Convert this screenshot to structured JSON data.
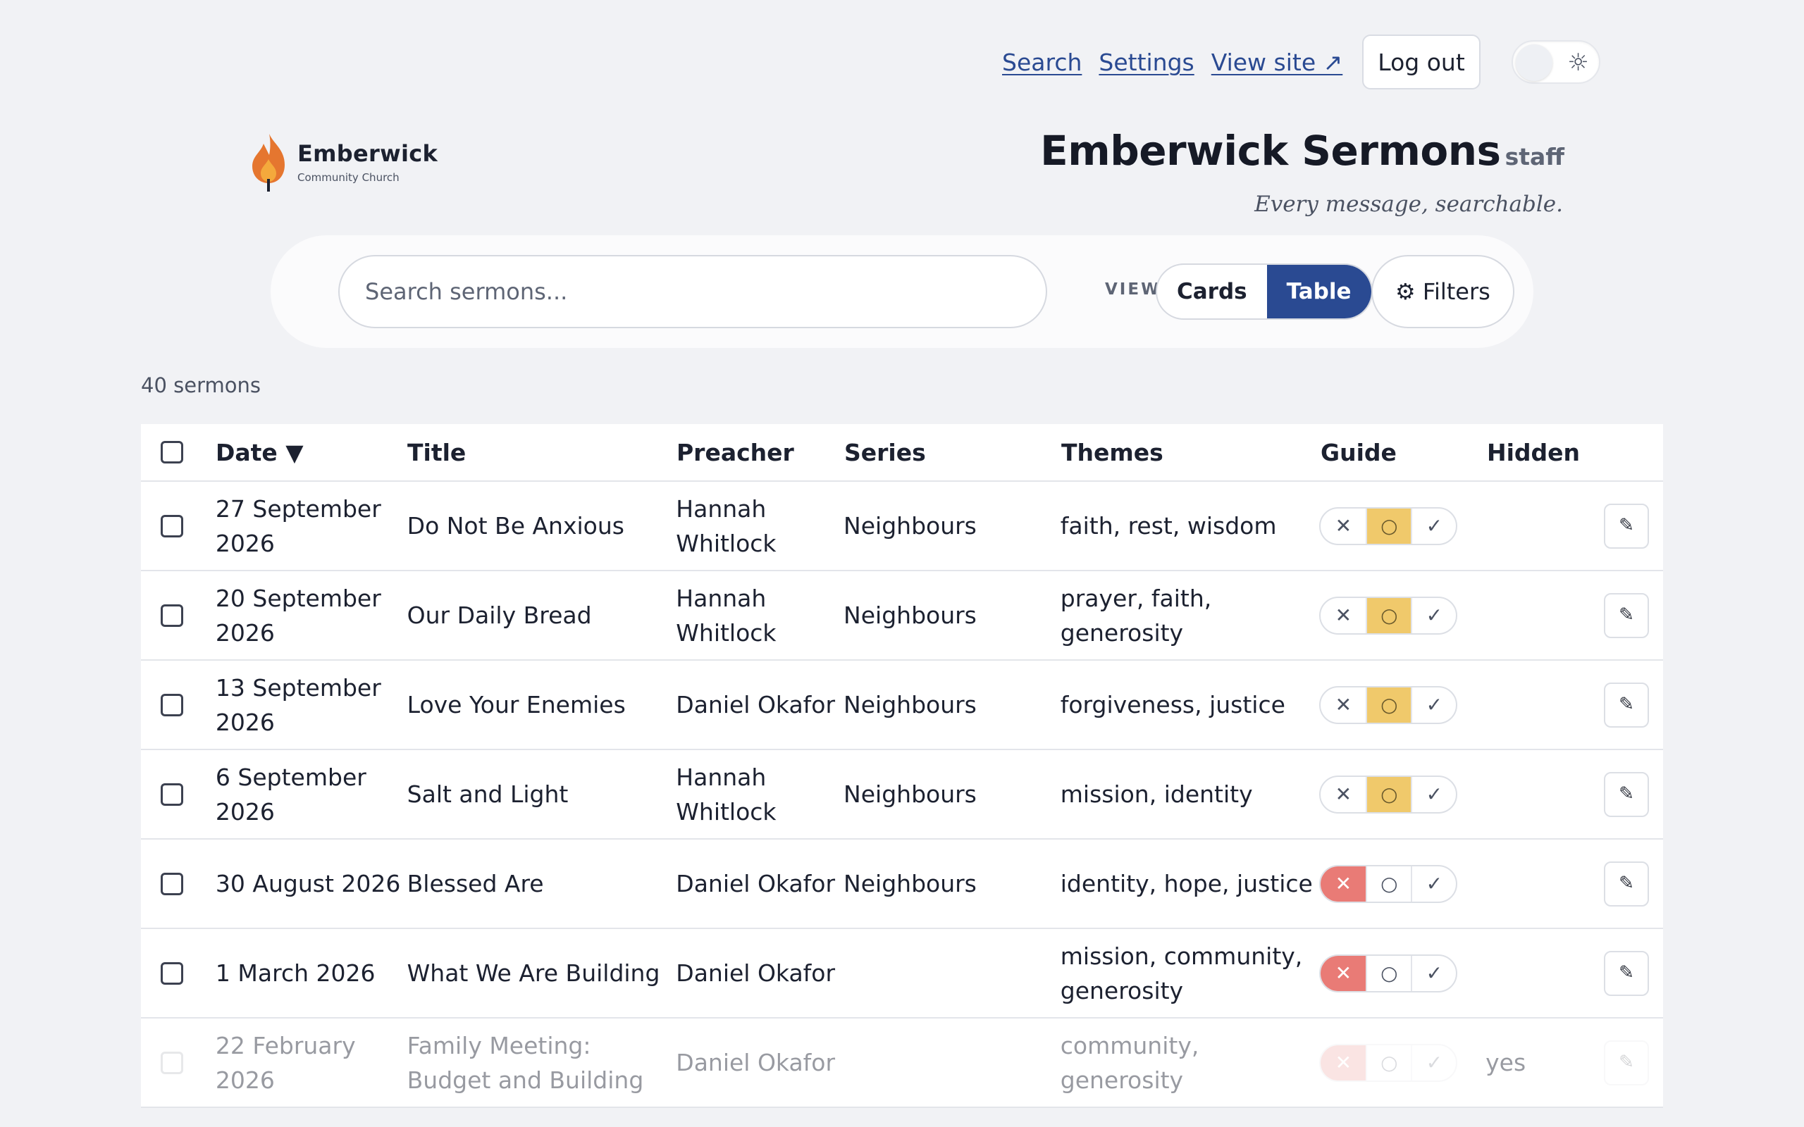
{
  "nav": {
    "search": "Search",
    "settings": "Settings",
    "view_site": "View site ↗",
    "logout": "Log out",
    "theme_icon": "sun-icon"
  },
  "brand": {
    "name": "Emberwick",
    "sub": "Community Church"
  },
  "header": {
    "title": "Emberwick Sermons",
    "role": "staff",
    "tagline": "Every message, searchable."
  },
  "search": {
    "placeholder": "Search sermons..."
  },
  "view": {
    "label": "VIEW",
    "cards": "Cards",
    "table": "Table",
    "active": "Table"
  },
  "filters_label": "⚙ Filters",
  "count": "40 sermons",
  "columns": {
    "date": "Date ▼",
    "title": "Title",
    "preacher": "Preacher",
    "series": "Series",
    "themes": "Themes",
    "guide": "Guide",
    "hidden": "Hidden"
  },
  "guide_glyphs": {
    "x": "✕",
    "mid": "○",
    "check": "✓"
  },
  "colors": {
    "accent": "#2a4a92",
    "guide_mid": "#f0c96b",
    "guide_x": "#e97b76"
  },
  "rows": [
    {
      "date": "27 September 2026",
      "title": "Do Not Be Anxious",
      "preacher": "Hannah Whitlock",
      "series": "Neighbours",
      "themes": "faith, rest, wisdom",
      "guide": "mid",
      "hidden": ""
    },
    {
      "date": "20 September 2026",
      "title": "Our Daily Bread",
      "preacher": "Hannah Whitlock",
      "series": "Neighbours",
      "themes": "prayer, faith, generosity",
      "guide": "mid",
      "hidden": ""
    },
    {
      "date": "13 September 2026",
      "title": "Love Your Enemies",
      "preacher": "Daniel Okafor",
      "series": "Neighbours",
      "themes": "forgiveness, justice",
      "guide": "mid",
      "hidden": ""
    },
    {
      "date": "6 September 2026",
      "title": "Salt and Light",
      "preacher": "Hannah Whitlock",
      "series": "Neighbours",
      "themes": "mission, identity",
      "guide": "mid",
      "hidden": ""
    },
    {
      "date": "30 August 2026",
      "title": "Blessed Are",
      "preacher": "Daniel Okafor",
      "series": "Neighbours",
      "themes": "identity, hope, justice",
      "guide": "x",
      "hidden": ""
    },
    {
      "date": "1 March 2026",
      "title": "What We Are Building",
      "preacher": "Daniel Okafor",
      "series": "",
      "themes": "mission, community, generosity",
      "guide": "x",
      "hidden": ""
    },
    {
      "date": "22 February 2026",
      "title": "Family Meeting: Budget and Building",
      "preacher": "Daniel Okafor",
      "series": "",
      "themes": "community, generosity",
      "guide": "x",
      "hidden": "yes"
    }
  ]
}
